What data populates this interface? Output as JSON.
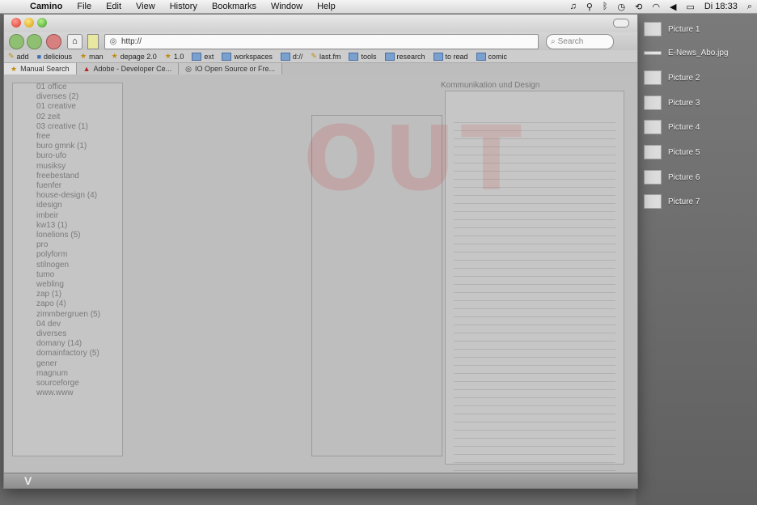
{
  "menubar": {
    "app": "Camino",
    "items": [
      "File",
      "Edit",
      "View",
      "History",
      "Bookmarks",
      "Window",
      "Help"
    ],
    "clock": "Di 18:33"
  },
  "window": {
    "url": "http://",
    "search_placeholder": "Search"
  },
  "bookmarks": [
    {
      "label": "add",
      "icon": "leaf-icon"
    },
    {
      "label": "delicious",
      "icon": "delicious-icon"
    },
    {
      "label": "man",
      "icon": "star-icon"
    },
    {
      "label": "depage 2.0",
      "icon": "star-icon"
    },
    {
      "label": "1.0",
      "icon": "star-icon"
    },
    {
      "label": "ext",
      "icon": "folder-icon"
    },
    {
      "label": "workspaces",
      "icon": "folder-icon"
    },
    {
      "label": "d://",
      "icon": "folder-icon"
    },
    {
      "label": "last.fm",
      "icon": "leaf-icon"
    },
    {
      "label": "tools",
      "icon": "folder-icon"
    },
    {
      "label": "research",
      "icon": "folder-icon"
    },
    {
      "label": "to read",
      "icon": "folder-icon"
    },
    {
      "label": "comic",
      "icon": "folder-icon"
    }
  ],
  "tabs": [
    {
      "label": "Manual Search",
      "active": true
    },
    {
      "label": "Adobe - Developer Ce...",
      "active": false
    },
    {
      "label": "IO Open Source or Fre...",
      "active": false
    }
  ],
  "background_list": [
    "01 office",
    "diverses (2)",
    "01 creative",
    "02 zeit",
    "03 creative (1)",
    "free",
    "buro gmnk (1)",
    "buro-ufo",
    "musiksy",
    "freebestand",
    "fuenfer",
    "house-design (4)",
    "idesign",
    "imbeir",
    "kw13 (1)",
    "lonelions (5)",
    "pro",
    "polyform",
    "stilnogen",
    "tumo",
    "webling",
    "zap (1)",
    "zapo (4)",
    "zimmbergruen (5)",
    "04 dev",
    "diverses",
    "domany (14)",
    "domainfactory (5)",
    "gener",
    "magnum",
    "sourceforge",
    "www.www"
  ],
  "background_heading": "Kommunikation und Design",
  "desktop_items": [
    {
      "label": "Picture 1",
      "kind": "thumb"
    },
    {
      "label": "E-News_Abo.jpg",
      "kind": "bar"
    },
    {
      "label": "Picture 2",
      "kind": "thumb"
    },
    {
      "label": "Picture 3",
      "kind": "thumb"
    },
    {
      "label": "Picture 4",
      "kind": "thumb"
    },
    {
      "label": "Picture 5",
      "kind": "thumb"
    },
    {
      "label": "Picture 6",
      "kind": "thumb"
    },
    {
      "label": "Picture 7",
      "kind": "thumb"
    }
  ]
}
